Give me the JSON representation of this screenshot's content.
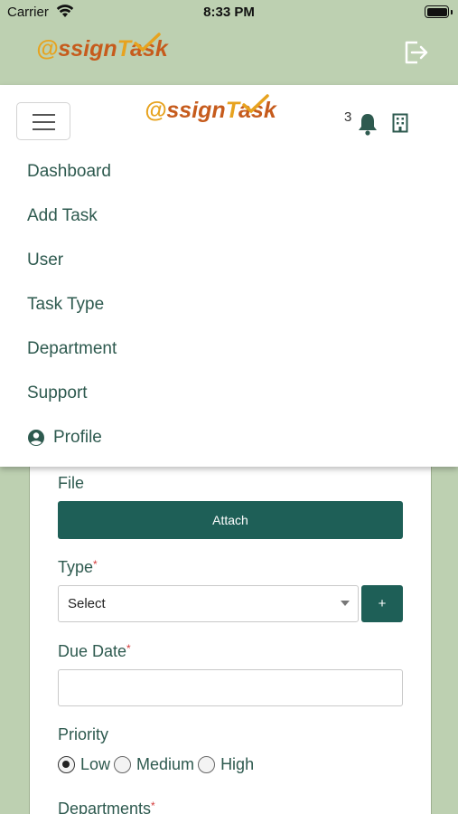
{
  "status_bar": {
    "carrier": "Carrier",
    "time": "8:33 PM",
    "battery_level": 1.0
  },
  "header": {
    "logo_at": "@",
    "logo_text": "ssign",
    "logo_t": "T",
    "logo_end": "ask",
    "logout_icon": "logout-icon"
  },
  "drawer": {
    "logo_at": "@",
    "logo_text": "ssign",
    "logo_t": "T",
    "logo_end": "ask",
    "notification_count": "3",
    "menu_items": [
      {
        "label": "Dashboard"
      },
      {
        "label": "Add Task"
      },
      {
        "label": "User"
      },
      {
        "label": "Task Type"
      },
      {
        "label": "Department"
      },
      {
        "label": "Support"
      },
      {
        "label": "Profile",
        "icon": "person-circle-icon"
      }
    ]
  },
  "form": {
    "file_label": "File",
    "attach_label": "Attach",
    "type_label": "Type",
    "required_mark": "*",
    "type_value": "Select",
    "add_type_label": "+",
    "due_date_label": "Due Date",
    "due_date_value": "",
    "priority_label": "Priority",
    "priority_options": [
      "Low",
      "Medium",
      "High"
    ],
    "priority_selected": "Low",
    "departments_label": "Departments"
  },
  "colors": {
    "brand_green": "#1e5f57",
    "page_bg": "#bdd0b1",
    "text_green": "#2e5a4f",
    "logo_orange": "#c65b1c",
    "logo_yellow": "#e7a31f",
    "required_red": "#d43b3b"
  }
}
